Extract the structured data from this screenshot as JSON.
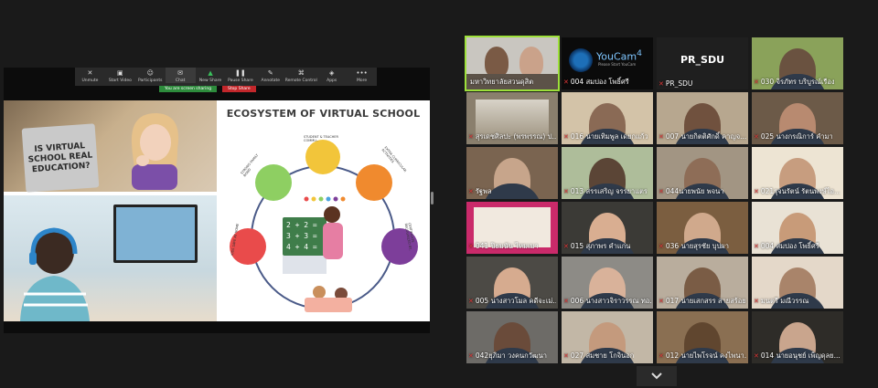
{
  "toolbar": {
    "items": [
      {
        "label": "Unmute",
        "icon": "mic-muted-icon",
        "glyph": "✕"
      },
      {
        "label": "Start Video",
        "icon": "video-off-icon",
        "glyph": "▣"
      },
      {
        "label": "Participants",
        "icon": "participants-icon",
        "glyph": "☺"
      },
      {
        "label": "Chat",
        "icon": "chat-icon",
        "glyph": "✉"
      },
      {
        "label": "New Share",
        "icon": "share-screen-icon",
        "glyph": "▲"
      },
      {
        "label": "Pause Share",
        "icon": "pause-icon",
        "glyph": "❚❚"
      },
      {
        "label": "Annotate",
        "icon": "pen-icon",
        "glyph": "✎"
      },
      {
        "label": "Remote Control",
        "icon": "remote-control-icon",
        "glyph": "⌘"
      },
      {
        "label": "Apps",
        "icon": "apps-icon",
        "glyph": "◈"
      },
      {
        "label": "More",
        "icon": "more-icon",
        "glyph": "•••"
      }
    ],
    "sharing_notice": "You are screen sharing",
    "stop_share": "Stop Share"
  },
  "slide": {
    "laptop_text": "IS VIRTUAL SCHOOL REAL EDUCATION?",
    "title": "ECOSYSTEM OF VIRTUAL SCHOOL",
    "nodes": [
      "STRONG FAMILY BOND",
      "STUDENT & TEACHER COMMU..",
      "EXTRA CURRICULAR ACTIVITIES",
      "CERTIFICATE RECOGNIZED BY..",
      "KIDS SAFE AT HOME"
    ],
    "board_lines": [
      "2 + 2 =",
      "3 + 3 =",
      "4 + 4 ="
    ]
  },
  "tiles": [
    {
      "name": "มหาวิทยาลัยสวนดุสิต",
      "muted": false,
      "bg": "#c9c6c0",
      "kind": "people2",
      "active": true
    },
    {
      "name": "004 สมปอง โพธิ์ศรี",
      "muted": true,
      "bg": "#0b0b0b",
      "kind": "youcam",
      "logo": "YouCam",
      "logo_num": "4",
      "logo_sub": "Please Start YouCam"
    },
    {
      "name": "PR_SDU",
      "muted": true,
      "bg": "#1f1f1f",
      "kind": "text",
      "label": "PR_SDU"
    },
    {
      "name": "030 จิรภัทร บริบูรณ์เรือง",
      "muted": true,
      "bg": "#8aa25a",
      "kind": "person",
      "face": "#6a5240"
    },
    {
      "name": "สุรเดชศิลปะ (พรพรรณ) ป...",
      "muted": true,
      "bg": "#8a7f6d",
      "kind": "building"
    },
    {
      "name": "016 นายเทิมพูล เดยกแก้ว",
      "muted": true,
      "bg": "#d3c3a8",
      "kind": "person",
      "face": "#8a6a55"
    },
    {
      "name": "007 นายกิตติศักดิ์ คาญจ...",
      "muted": true,
      "bg": "#b7a78f",
      "kind": "person",
      "face": "#70513e"
    },
    {
      "name": "025 นางกรณิการ์ คำมา",
      "muted": true,
      "bg": "#6c5a48",
      "kind": "person",
      "face": "#b88a70"
    },
    {
      "name": "รัฐพล",
      "muted": true,
      "bg": "#7a6450",
      "kind": "person",
      "face": "#c7a58b"
    },
    {
      "name": "013 สรรเสริญ จรรยาแตร",
      "muted": true,
      "bg": "#aebd9a",
      "kind": "person",
      "face": "#5b4536"
    },
    {
      "name": "044นายพนัย พจนา",
      "muted": true,
      "bg": "#a29583",
      "kind": "person",
      "face": "#8e6d57"
    },
    {
      "name": "021รุจนรัตน์ รัตนพงษ์ไอ...",
      "muted": true,
      "bg": "#ede4d3",
      "kind": "person",
      "face": "#c79d7f"
    },
    {
      "name": "041 ปิยมนัน ไหมเมา",
      "muted": true,
      "bg": "#ca2a6a",
      "kind": "slide"
    },
    {
      "name": "015 สุภาพร คำแก่น",
      "muted": true,
      "bg": "#3b3a36",
      "kind": "person",
      "face": "#d9ae91"
    },
    {
      "name": "036 นายสุรชัย บุปผา",
      "muted": true,
      "bg": "#7b5e40",
      "kind": "person",
      "face": "#d0a98c"
    },
    {
      "name": "004 สมปอง โพธิ์ศรี",
      "muted": true,
      "bg": "#e9e2d5",
      "kind": "person",
      "face": "#c89b79"
    },
    {
      "name": "005 นางสาวโมล คดีจะเม่...",
      "muted": true,
      "bg": "#4c4a45",
      "kind": "person",
      "face": "#d6ab8f"
    },
    {
      "name": "006 นางสาวจิราวรรณ ทอ...",
      "muted": true,
      "bg": "#8d8b86",
      "kind": "person",
      "face": "#d9b29a"
    },
    {
      "name": "017 นายเสกสรร สายสร้อย...",
      "muted": true,
      "bg": "#b9ad9d",
      "kind": "person",
      "face": "#7a5c45"
    },
    {
      "name": "มนตรี มณีวรรณ",
      "muted": true,
      "bg": "#e4d8c9",
      "kind": "person",
      "face": "#a9846a"
    },
    {
      "name": "042ยุภิมา วงคนกวัฒนา",
      "muted": true,
      "bg": "#6d6b67",
      "kind": "person",
      "face": "#6a4b3a"
    },
    {
      "name": "027 สมชาย โกจินอก",
      "muted": true,
      "bg": "#c2b7a6",
      "kind": "person",
      "face": "#c49a7d"
    },
    {
      "name": "012 นายไพโรจน์ คงไพนา...",
      "muted": true,
      "bg": "#8a6f52",
      "kind": "person",
      "face": "#60462f"
    },
    {
      "name": "014 นายอนุชย์ เพ็ญดุลย...",
      "muted": true,
      "bg": "#2e2c28",
      "kind": "person",
      "face": "#c9a58d"
    }
  ],
  "colors": {
    "background": "#1a1a1a",
    "active_border": "#9de03a",
    "muted_red": "#e03a3a",
    "share_green": "#2d8c3c",
    "stop_red": "#c3272b"
  }
}
